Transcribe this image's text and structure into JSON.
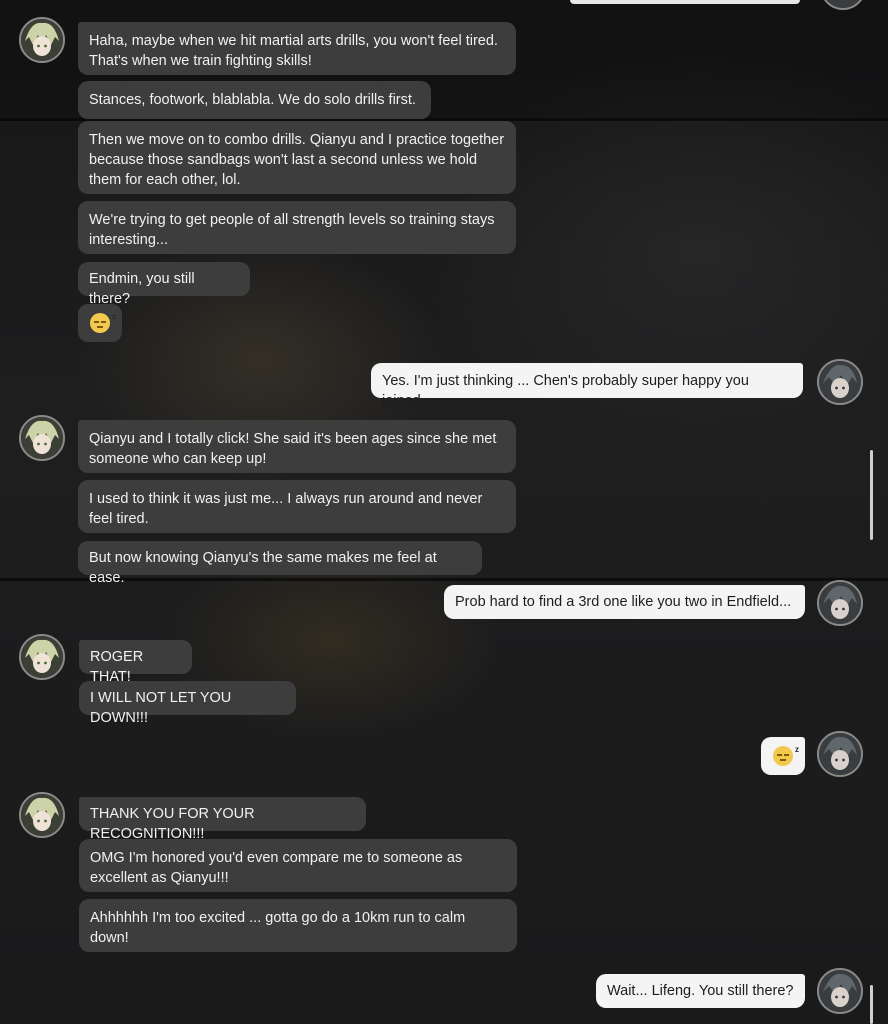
{
  "chat": {
    "contact_avatar": "avatar-lifeng",
    "user_avatar": "avatar-endmin",
    "messages": [
      {
        "side": "in",
        "text": "Haha, maybe when we hit martial arts drills, you won't feel tired. That's when we train fighting skills!"
      },
      {
        "side": "in",
        "text": "Stances, footwork, blablabla. We do solo drills first."
      },
      {
        "side": "in",
        "text": "Then we move on to combo drills. Qianyu and I practice together because those sandbags won't last a second unless we hold them for each other, lol."
      },
      {
        "side": "in",
        "text": "We're trying to get people of all strength levels so training stays interesting..."
      },
      {
        "side": "in",
        "text": "Endmin, you still there?"
      },
      {
        "side": "in",
        "emoji": "sleepy-face-emoji"
      },
      {
        "side": "out",
        "text": "Yes. I'm just thinking ... Chen's probably super happy you joined."
      },
      {
        "side": "in",
        "text": "Qianyu and I totally click! She said it's been ages since she met someone who can keep up!"
      },
      {
        "side": "in",
        "text": "I used to think it was just me... I always run around and never feel tired."
      },
      {
        "side": "in",
        "text": "But now knowing Qianyu's the same makes me feel at ease."
      },
      {
        "side": "out",
        "text": "Prob hard to find a 3rd one like you two in Endfield..."
      },
      {
        "side": "in",
        "text": "ROGER THAT!"
      },
      {
        "side": "in",
        "text": "I WILL NOT LET YOU DOWN!!!"
      },
      {
        "side": "out",
        "emoji": "sleepy-face-emoji"
      },
      {
        "side": "in",
        "text": "THANK YOU FOR YOUR RECOGNITION!!!"
      },
      {
        "side": "in",
        "text": "OMG I'm honored you'd even compare me to someone as excellent as Qianyu!!!"
      },
      {
        "side": "in",
        "text": "Ahhhhhh I'm too excited ... gotta go do a 10km run to calm down!"
      },
      {
        "side": "out",
        "text": "Wait... Lifeng. You still there?"
      }
    ]
  },
  "colors": {
    "incoming_bubble": "#3d3d3e",
    "outgoing_bubble": "#f4f4f4",
    "background": "#1b1b1c"
  }
}
